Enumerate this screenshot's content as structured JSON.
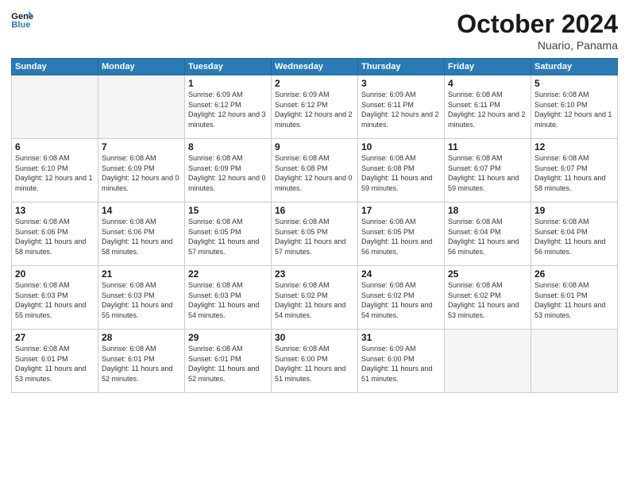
{
  "header": {
    "logo_general": "General",
    "logo_blue": "Blue",
    "month_title": "October 2024",
    "location": "Nuario, Panama"
  },
  "weekdays": [
    "Sunday",
    "Monday",
    "Tuesday",
    "Wednesday",
    "Thursday",
    "Friday",
    "Saturday"
  ],
  "weeks": [
    [
      {
        "day": "",
        "empty": true
      },
      {
        "day": "",
        "empty": true
      },
      {
        "day": "1",
        "sunrise": "6:09 AM",
        "sunset": "6:12 PM",
        "daylight": "12 hours and 3 minutes."
      },
      {
        "day": "2",
        "sunrise": "6:09 AM",
        "sunset": "6:12 PM",
        "daylight": "12 hours and 2 minutes."
      },
      {
        "day": "3",
        "sunrise": "6:09 AM",
        "sunset": "6:11 PM",
        "daylight": "12 hours and 2 minutes."
      },
      {
        "day": "4",
        "sunrise": "6:08 AM",
        "sunset": "6:11 PM",
        "daylight": "12 hours and 2 minutes."
      },
      {
        "day": "5",
        "sunrise": "6:08 AM",
        "sunset": "6:10 PM",
        "daylight": "12 hours and 1 minute."
      }
    ],
    [
      {
        "day": "6",
        "sunrise": "6:08 AM",
        "sunset": "6:10 PM",
        "daylight": "12 hours and 1 minute."
      },
      {
        "day": "7",
        "sunrise": "6:08 AM",
        "sunset": "6:09 PM",
        "daylight": "12 hours and 0 minutes."
      },
      {
        "day": "8",
        "sunrise": "6:08 AM",
        "sunset": "6:09 PM",
        "daylight": "12 hours and 0 minutes."
      },
      {
        "day": "9",
        "sunrise": "6:08 AM",
        "sunset": "6:08 PM",
        "daylight": "12 hours and 0 minutes."
      },
      {
        "day": "10",
        "sunrise": "6:08 AM",
        "sunset": "6:08 PM",
        "daylight": "11 hours and 59 minutes."
      },
      {
        "day": "11",
        "sunrise": "6:08 AM",
        "sunset": "6:07 PM",
        "daylight": "11 hours and 59 minutes."
      },
      {
        "day": "12",
        "sunrise": "6:08 AM",
        "sunset": "6:07 PM",
        "daylight": "11 hours and 58 minutes."
      }
    ],
    [
      {
        "day": "13",
        "sunrise": "6:08 AM",
        "sunset": "6:06 PM",
        "daylight": "11 hours and 58 minutes."
      },
      {
        "day": "14",
        "sunrise": "6:08 AM",
        "sunset": "6:06 PM",
        "daylight": "11 hours and 58 minutes."
      },
      {
        "day": "15",
        "sunrise": "6:08 AM",
        "sunset": "6:05 PM",
        "daylight": "11 hours and 57 minutes."
      },
      {
        "day": "16",
        "sunrise": "6:08 AM",
        "sunset": "6:05 PM",
        "daylight": "11 hours and 57 minutes."
      },
      {
        "day": "17",
        "sunrise": "6:08 AM",
        "sunset": "6:05 PM",
        "daylight": "11 hours and 56 minutes."
      },
      {
        "day": "18",
        "sunrise": "6:08 AM",
        "sunset": "6:04 PM",
        "daylight": "11 hours and 56 minutes."
      },
      {
        "day": "19",
        "sunrise": "6:08 AM",
        "sunset": "6:04 PM",
        "daylight": "11 hours and 56 minutes."
      }
    ],
    [
      {
        "day": "20",
        "sunrise": "6:08 AM",
        "sunset": "6:03 PM",
        "daylight": "11 hours and 55 minutes."
      },
      {
        "day": "21",
        "sunrise": "6:08 AM",
        "sunset": "6:03 PM",
        "daylight": "11 hours and 55 minutes."
      },
      {
        "day": "22",
        "sunrise": "6:08 AM",
        "sunset": "6:03 PM",
        "daylight": "11 hours and 54 minutes."
      },
      {
        "day": "23",
        "sunrise": "6:08 AM",
        "sunset": "6:02 PM",
        "daylight": "11 hours and 54 minutes."
      },
      {
        "day": "24",
        "sunrise": "6:08 AM",
        "sunset": "6:02 PM",
        "daylight": "11 hours and 54 minutes."
      },
      {
        "day": "25",
        "sunrise": "6:08 AM",
        "sunset": "6:02 PM",
        "daylight": "11 hours and 53 minutes."
      },
      {
        "day": "26",
        "sunrise": "6:08 AM",
        "sunset": "6:01 PM",
        "daylight": "11 hours and 53 minutes."
      }
    ],
    [
      {
        "day": "27",
        "sunrise": "6:08 AM",
        "sunset": "6:01 PM",
        "daylight": "11 hours and 53 minutes."
      },
      {
        "day": "28",
        "sunrise": "6:08 AM",
        "sunset": "6:01 PM",
        "daylight": "11 hours and 52 minutes."
      },
      {
        "day": "29",
        "sunrise": "6:08 AM",
        "sunset": "6:01 PM",
        "daylight": "11 hours and 52 minutes."
      },
      {
        "day": "30",
        "sunrise": "6:08 AM",
        "sunset": "6:00 PM",
        "daylight": "11 hours and 51 minutes."
      },
      {
        "day": "31",
        "sunrise": "6:09 AM",
        "sunset": "6:00 PM",
        "daylight": "11 hours and 51 minutes."
      },
      {
        "day": "",
        "empty": true
      },
      {
        "day": "",
        "empty": true
      }
    ]
  ]
}
